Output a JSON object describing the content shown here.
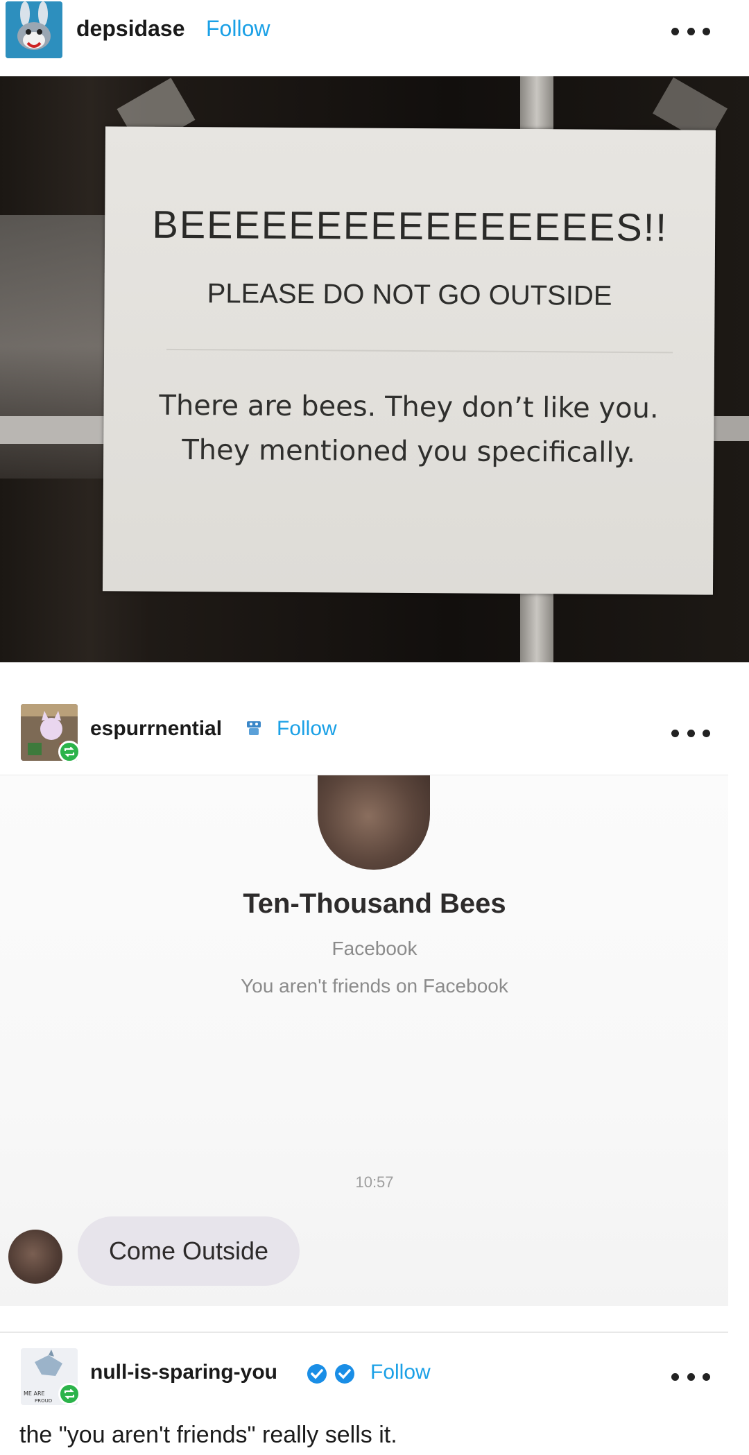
{
  "post1": {
    "username": "depsidase",
    "follow_label": "Follow",
    "photo": {
      "sign_title": "BEEEEEEEEEEEEEEEES!!",
      "sign_subtitle": "PLEASE DO NOT GO OUTSIDE",
      "sign_body": "There are bees. They don’t like you. They mentioned you specifically."
    }
  },
  "post2": {
    "username": "espurrnential",
    "follow_label": "Follow",
    "screenshot": {
      "profile_name": "Ten-Thousand Bees",
      "platform": "Facebook",
      "friend_status": "You aren't friends on Facebook",
      "timestamp": "10:57",
      "message": "Come Outside"
    }
  },
  "post3": {
    "username": "null-is-sparing-you",
    "follow_label": "Follow",
    "text": "the \"you aren't friends\" really sells it."
  },
  "colors": {
    "follow": "#1aa0e6",
    "reblog_badge": "#2bb34a",
    "verified": "#1a8ee6"
  }
}
